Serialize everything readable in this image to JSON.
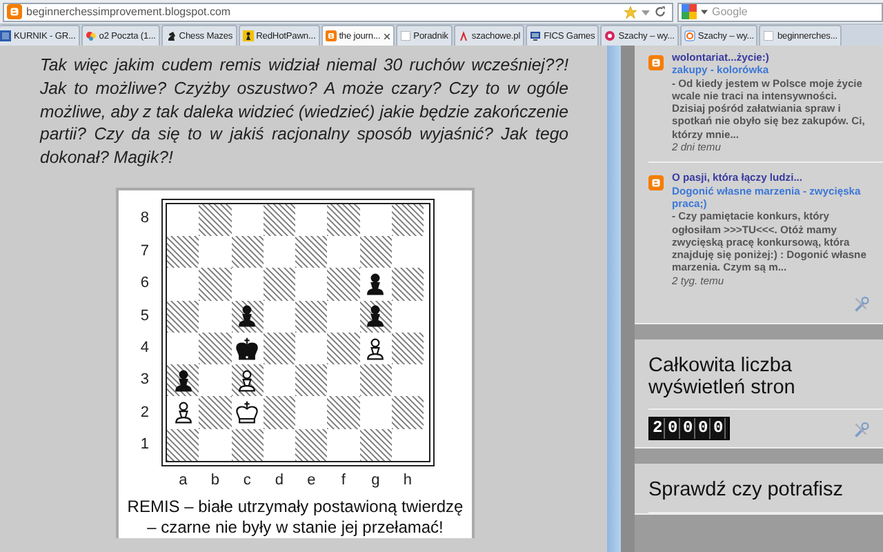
{
  "browser": {
    "address": {
      "value": "beginnerchessimprovement.blogspot.com"
    },
    "search": {
      "placeholder": "Google"
    },
    "tabs": [
      {
        "label": "KURNIK - GR...",
        "kind": "tile",
        "selected": false
      },
      {
        "label": "o2 Poczta (1...",
        "kind": "blob",
        "selected": false
      },
      {
        "label": "Chess Mazes",
        "kind": "knight",
        "selected": false
      },
      {
        "label": "RedHotPawn...",
        "kind": "pawn",
        "selected": false
      },
      {
        "label": "the journ...",
        "kind": "blogger",
        "selected": true
      },
      {
        "label": "Poradnik",
        "kind": "blank",
        "selected": false
      },
      {
        "label": "szachowe.pl",
        "kind": "figure",
        "selected": false
      },
      {
        "label": "FICS Games",
        "kind": "monitor",
        "selected": false
      },
      {
        "label": "Szachy – wy...",
        "kind": "circle",
        "selected": false
      },
      {
        "label": "Szachy – wy...",
        "kind": "ring",
        "selected": false
      },
      {
        "label": "beginnerches...",
        "kind": "blank",
        "selected": false
      }
    ]
  },
  "post": {
    "paragraph": "Tak więc jakim cudem remis widział niemal 30 ruchów wcześniej??! Jak to możliwe? Czyżby oszustwo? A może czary? Czy to w ogóle możliwe, aby z tak daleka widzieć (wiedzieć) jakie będzie zakończenie partii? Czy da się to w jakiś racjonalny sposób wyjaśnić? Jak tego dokonał? Magik?!",
    "diagram": {
      "ranks": [
        "8",
        "7",
        "6",
        "5",
        "4",
        "3",
        "2",
        "1"
      ],
      "files": [
        "a",
        "b",
        "c",
        "d",
        "e",
        "f",
        "g",
        "h"
      ],
      "rows": [
        {
          "cells": [
            {
              "kind": "empty"
            },
            {
              "kind": "empty"
            },
            {
              "kind": "empty"
            },
            {
              "kind": "empty"
            },
            {
              "kind": "empty"
            },
            {
              "kind": "empty"
            },
            {
              "kind": "empty"
            },
            {
              "kind": "empty"
            }
          ]
        },
        {
          "cells": [
            {
              "kind": "empty"
            },
            {
              "kind": "empty"
            },
            {
              "kind": "empty"
            },
            {
              "kind": "empty"
            },
            {
              "kind": "empty"
            },
            {
              "kind": "empty"
            },
            {
              "kind": "empty"
            },
            {
              "kind": "empty"
            }
          ]
        },
        {
          "cells": [
            {
              "kind": "empty"
            },
            {
              "kind": "empty"
            },
            {
              "kind": "empty"
            },
            {
              "kind": "empty"
            },
            {
              "kind": "empty"
            },
            {
              "kind": "empty"
            },
            {
              "kind": "black-pawn"
            },
            {
              "kind": "empty"
            }
          ]
        },
        {
          "cells": [
            {
              "kind": "empty"
            },
            {
              "kind": "empty"
            },
            {
              "kind": "black-pawn"
            },
            {
              "kind": "empty"
            },
            {
              "kind": "empty"
            },
            {
              "kind": "empty"
            },
            {
              "kind": "black-pawn"
            },
            {
              "kind": "empty"
            }
          ]
        },
        {
          "cells": [
            {
              "kind": "empty"
            },
            {
              "kind": "empty"
            },
            {
              "kind": "black-king"
            },
            {
              "kind": "empty"
            },
            {
              "kind": "empty"
            },
            {
              "kind": "empty"
            },
            {
              "kind": "white-pawn"
            },
            {
              "kind": "empty"
            }
          ]
        },
        {
          "cells": [
            {
              "kind": "black-pawn"
            },
            {
              "kind": "empty"
            },
            {
              "kind": "white-pawn"
            },
            {
              "kind": "empty"
            },
            {
              "kind": "empty"
            },
            {
              "kind": "empty"
            },
            {
              "kind": "empty"
            },
            {
              "kind": "empty"
            }
          ]
        },
        {
          "cells": [
            {
              "kind": "white-pawn"
            },
            {
              "kind": "empty"
            },
            {
              "kind": "white-king"
            },
            {
              "kind": "empty"
            },
            {
              "kind": "empty"
            },
            {
              "kind": "empty"
            },
            {
              "kind": "empty"
            },
            {
              "kind": "empty"
            }
          ]
        },
        {
          "cells": [
            {
              "kind": "empty"
            },
            {
              "kind": "empty"
            },
            {
              "kind": "empty"
            },
            {
              "kind": "empty"
            },
            {
              "kind": "empty"
            },
            {
              "kind": "empty"
            },
            {
              "kind": "empty"
            },
            {
              "kind": "empty"
            }
          ]
        }
      ],
      "caption": "REMIS – białe utrzymały postawioną twierdzę – czarne nie były w stanie jej przełamać!"
    }
  },
  "sidebar": {
    "posts": [
      {
        "title": "wolontariat...życie:)",
        "link": "zakupy - kolorówka",
        "snippet": "- Od kiedy jestem w Polsce moje życie wcale nie traci na intensywności. Dzisiaj pośród załatwiania spraw i spotkań nie obyło się bez zakupów. Ci, którzy mnie...",
        "time": "2 dni temu"
      },
      {
        "title": "O pasji, która łączy ludzi...",
        "link": "Dogonić własne marzenia - zwycięska praca;)",
        "snippet": "- Czy pamiętacie konkurs, który ogłosiłam >>>TU<<<. Otóż mamy zwycięską pracę konkursową, która znajduję się poniżej:) : Dogonić własne marzenia. Czym są m...",
        "time": "2 tyg. temu"
      }
    ],
    "widgets": [
      {
        "title": "Całkowita liczba wyświetleń stron",
        "counter": "20000"
      },
      {
        "title": "Sprawdź czy potrafisz"
      }
    ]
  }
}
